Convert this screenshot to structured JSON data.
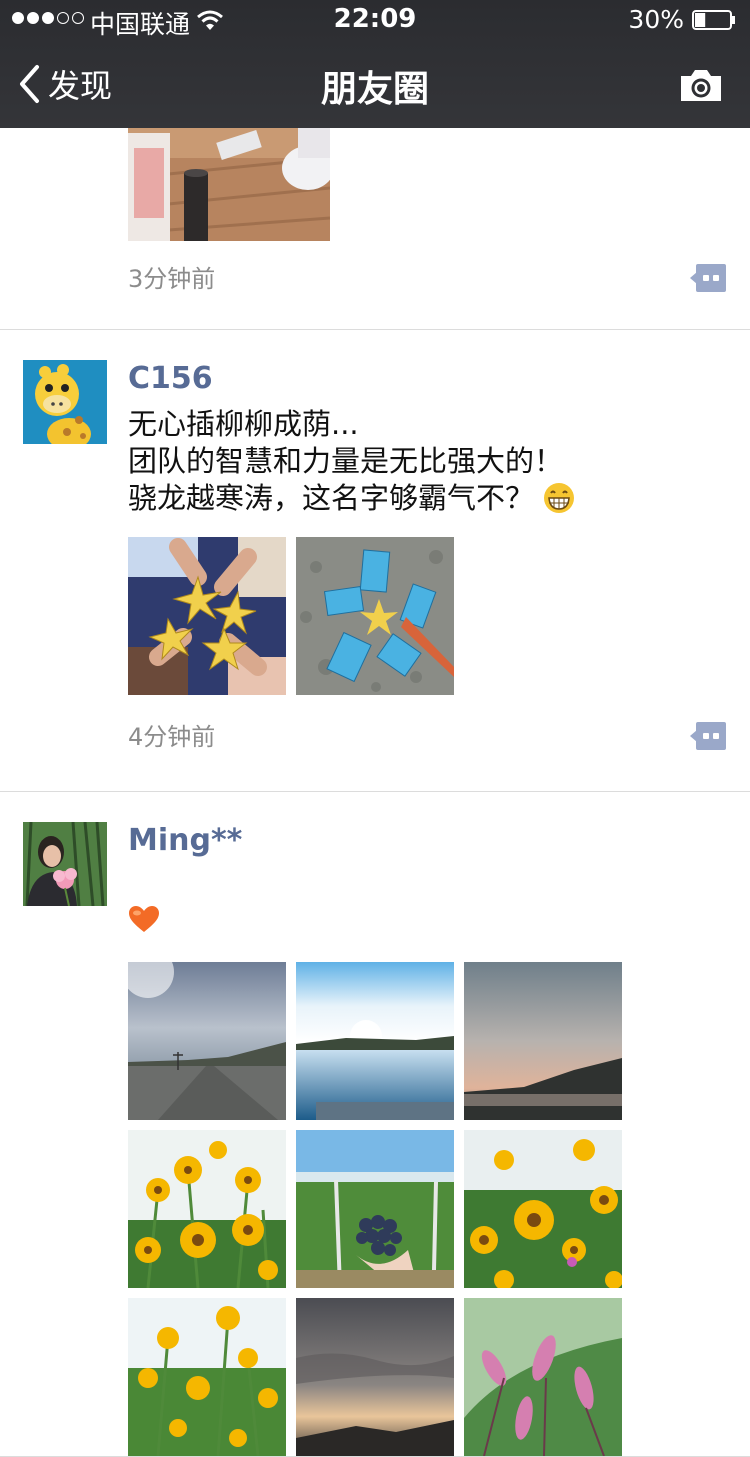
{
  "status_bar": {
    "carrier": "中国联通",
    "time": "22:09",
    "battery": "30%",
    "battery_level": 0.3
  },
  "nav": {
    "back_label": "发现",
    "title": "朋友圈",
    "camera_icon": "camera-icon"
  },
  "posts": [
    {
      "time": "3分钟前"
    },
    {
      "nickname": "C156",
      "text": "无心插柳柳成荫...\n团队的智慧和力量是无比强大的！\n骁龙越寒涛，这名字够霸气不？",
      "emoji": "grinning-face-icon",
      "time": "4分钟前"
    },
    {
      "nickname": "Ming**",
      "emoji": "orange-heart-icon"
    }
  ],
  "colors": {
    "nickname": "#576b95",
    "timestamp": "#8c8c8c",
    "bar": "#2b2c30",
    "comment_button": "#9aa8c9"
  }
}
